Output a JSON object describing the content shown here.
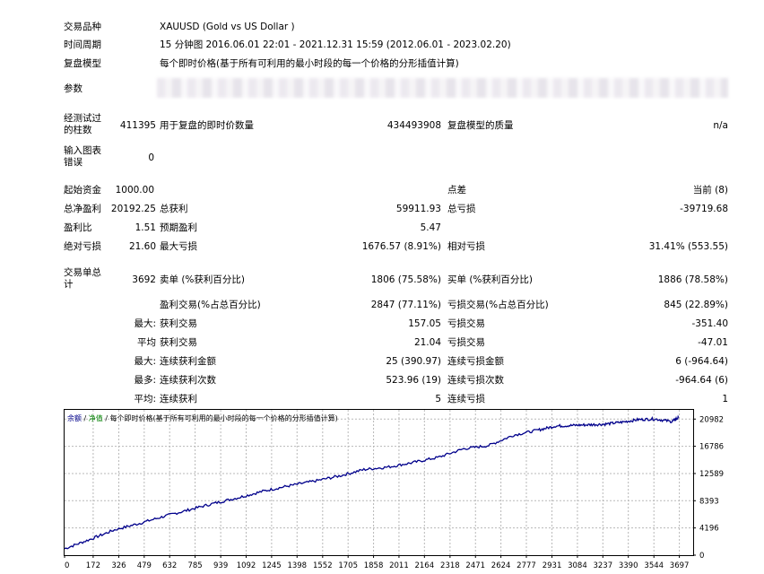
{
  "report": {
    "symbol_label": "交易品种",
    "symbol_value": "XAUUSD (Gold vs US Dollar )",
    "period_label": "时间周期",
    "period_value": "15 分钟图 2016.06.01 22:01 - 2021.12.31 15:59 (2012.06.01 - 2023.02.20)",
    "model_label": "复盘模型",
    "model_value": "每个即时价格(基于所有可利用的最小时段的每一个价格的分形插值计算)",
    "params_label": "参数",
    "bars_label": "经测试过的柱数",
    "bars_value": "411395",
    "ticks_label": "用于复盘的即时价数量",
    "ticks_value": "434493908",
    "quality_label": "复盘模型的质量",
    "quality_value": "n/a",
    "errors_label": "输入图表错误",
    "errors_value": "0",
    "deposit_label": "起始资金",
    "deposit_value": "1000.00",
    "spread_label": "点差",
    "spread_value": "当前 (8)",
    "net_label": "总净盈利",
    "net_value": "20192.25",
    "gross_profit_label": "总获利",
    "gross_profit_value": "59911.93",
    "gross_loss_label": "总亏损",
    "gross_loss_value": "-39719.68",
    "pf_label": "盈利比",
    "pf_value": "1.51",
    "expected_label": "预期盈利",
    "expected_value": "5.47",
    "abs_dd_label": "绝对亏损",
    "abs_dd_value": "21.60",
    "max_dd_label": "最大亏损",
    "max_dd_value": "1676.57 (8.91%)",
    "rel_dd_label": "相对亏损",
    "rel_dd_value": "31.41% (553.55)",
    "trades_label": "交易单总计",
    "trades_value": "3692",
    "short_label": "卖单 (%获利百分比)",
    "short_value": "1806 (75.58%)",
    "long_label": "买单 (%获利百分比)",
    "long_value": "1886 (78.58%)",
    "profit_trades_label": "盈利交易(%占总百分比)",
    "profit_trades_value": "2847 (77.11%)",
    "loss_trades_label": "亏损交易(%占总百分比)",
    "loss_trades_value": "845 (22.89%)",
    "largest_label": "最大:",
    "largest_profit_label": "获利交易",
    "largest_profit_value": "157.05",
    "largest_loss_label": "亏损交易",
    "largest_loss_value": "-351.40",
    "average_label": "平均",
    "avg_profit_label": "获利交易",
    "avg_profit_value": "21.04",
    "avg_loss_label": "亏损交易",
    "avg_loss_value": "-47.01",
    "max_cons_label": "最大:",
    "max_cons_wins_label": "连续获利金额",
    "max_cons_wins_value": "25 (390.97)",
    "max_cons_losses_label": "连续亏损金额",
    "max_cons_losses_value": "6 (-964.64)",
    "maximal_label": "最多:",
    "maximal_wins_label": "连续获利次数",
    "maximal_wins_value": "523.96 (19)",
    "maximal_losses_label": "连续亏损次数",
    "maximal_losses_value": "-964.64 (6)",
    "avg_cons_label": "平均:",
    "avg_cons_wins_label": "连续获利",
    "avg_cons_wins_value": "5",
    "avg_cons_losses_label": "连续亏损",
    "avg_cons_losses_value": "1"
  },
  "chart_data": {
    "type": "line",
    "legend_balance": "余额",
    "legend_sep1": " / ",
    "legend_equity": "净值",
    "legend_sep2": " / ",
    "legend_model": "每个即时价格(基于所有可利用的最小时段的每一个价格的分形插值计算)",
    "x_ticks": [
      "0",
      "172",
      "326",
      "479",
      "632",
      "785",
      "939",
      "1092",
      "1245",
      "1398",
      "1552",
      "1705",
      "1858",
      "2011",
      "2164",
      "2318",
      "2471",
      "2624",
      "2777",
      "2931",
      "3084",
      "3237",
      "3390",
      "3544",
      "3697"
    ],
    "y_ticks": [
      "0",
      "4196",
      "8393",
      "12589",
      "16786",
      "20982"
    ],
    "xlim": [
      0,
      3780
    ],
    "ylim": [
      0,
      22400
    ],
    "series": [
      {
        "name": "余额",
        "color": "#00008b",
        "x": [
          0,
          150,
          300,
          450,
          600,
          750,
          900,
          1050,
          1200,
          1350,
          1500,
          1650,
          1800,
          1950,
          2100,
          2250,
          2400,
          2550,
          2700,
          2850,
          2950,
          3050,
          3150,
          3250,
          3350,
          3450,
          3550,
          3650,
          3692
        ],
        "y": [
          1000,
          2400,
          3900,
          4900,
          6000,
          7000,
          8000,
          8900,
          9900,
          10700,
          11400,
          12200,
          13200,
          13600,
          14300,
          15100,
          16400,
          16900,
          18500,
          19300,
          19900,
          20000,
          20100,
          20200,
          20500,
          20900,
          21000,
          20600,
          21200
        ]
      }
    ]
  }
}
